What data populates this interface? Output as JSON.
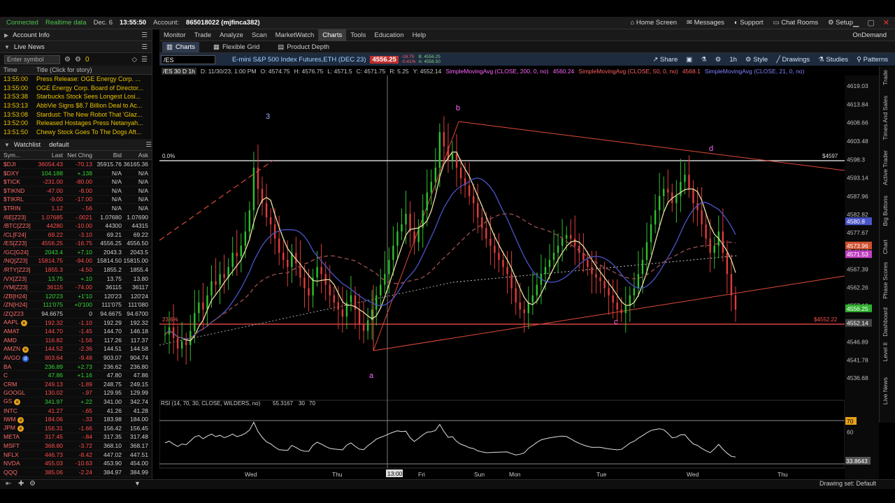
{
  "status": {
    "connected": "Connected",
    "realtime": "Realtime data",
    "date": "Dec. 6",
    "time": "13:55:50",
    "account_label": "Account:",
    "account": "865018022 (mjfinca382)"
  },
  "topnav": {
    "home": "Home Screen",
    "messages": "Messages",
    "support": "Support",
    "chat": "Chat Rooms",
    "setup": "Setup"
  },
  "left": {
    "account_info": "Account Info",
    "live_news": "Live News",
    "enter_symbol": "Enter symbol",
    "count": "0",
    "news_cols": [
      "Time",
      "Title (Click for story)"
    ],
    "news": [
      {
        "t": "13:55:00",
        "s": "Press Release: OGE Energy Corp. ..."
      },
      {
        "t": "13:55:00",
        "s": "OGE Energy Corp. Board of Director..."
      },
      {
        "t": "13:53:38",
        "s": "Starbucks Stock Sees Longest Losi..."
      },
      {
        "t": "13:53:13",
        "s": "AbbVie Signs $8.7 Billion Deal to Ac..."
      },
      {
        "t": "13:53:08",
        "s": "Stardust: The New Robot That 'Glaz..."
      },
      {
        "t": "13:52:00",
        "s": "Released Hostages Press Netanyah..."
      },
      {
        "t": "13:51:50",
        "s": "Chewy Stock Goes To The Dogs Aft..."
      }
    ],
    "watchlist_label": "Watchlist",
    "watchlist_name": "default",
    "wl_cols": [
      "Sym...",
      "Last",
      "Net Chng",
      "Bid",
      "Ask"
    ],
    "wl": [
      {
        "s": "$DJI",
        "l": "36054.43",
        "n": "-70.13",
        "b": "35915.76",
        "a": "36165.36",
        "d": "dn"
      },
      {
        "s": "$DXY",
        "l": "104.188",
        "n": "+.138",
        "b": "N/A",
        "a": "N/A",
        "d": "up"
      },
      {
        "s": "$TICK",
        "l": "-231.00",
        "n": "-80.00",
        "b": "N/A",
        "a": "N/A",
        "d": "dn"
      },
      {
        "s": "$TIKND",
        "l": "-47.00",
        "n": "-8.00",
        "b": "N/A",
        "a": "N/A",
        "d": "dn"
      },
      {
        "s": "$TIKRL",
        "l": "-9.00",
        "n": "-17.00",
        "b": "N/A",
        "a": "N/A",
        "d": "dn"
      },
      {
        "s": "$TRIN",
        "l": "1.12",
        "n": "-.56",
        "b": "N/A",
        "a": "N/A",
        "d": "dn"
      },
      {
        "s": "/6E[Z23]",
        "l": "1.07685",
        "n": "-.0021",
        "b": "1.07680",
        "a": "1.07690",
        "d": "dn"
      },
      {
        "s": "/BTC[Z23]",
        "l": "44280",
        "n": "-10.00",
        "b": "44300",
        "a": "44315",
        "d": "dn"
      },
      {
        "s": "/CL[F24]",
        "l": "69.22",
        "n": "-3.10",
        "b": "69.21",
        "a": "69.22",
        "d": "dn"
      },
      {
        "s": "/ES[Z23]",
        "l": "4556.25",
        "n": "-16.75",
        "b": "4556.25",
        "a": "4556.50",
        "d": "dn"
      },
      {
        "s": "/GC[G24]",
        "l": "2043.4",
        "n": "+7.10",
        "b": "2043.3",
        "a": "2043.5",
        "d": "up"
      },
      {
        "s": "/NQ[Z23]",
        "l": "15814.75",
        "n": "-94.00",
        "b": "15814.50",
        "a": "15815.00",
        "d": "dn"
      },
      {
        "s": "/RTY[Z23]",
        "l": "1855.3",
        "n": "-4.50",
        "b": "1855.2",
        "a": "1855.4",
        "d": "dn"
      },
      {
        "s": "/VX[Z23]",
        "l": "13.75",
        "n": "+.10",
        "b": "13.75",
        "a": "13.80",
        "d": "up"
      },
      {
        "s": "/YM[Z23]",
        "l": "36115",
        "n": "-74.00",
        "b": "36115",
        "a": "36117",
        "d": "dn"
      },
      {
        "s": "/ZB[H24]",
        "l": "120'23",
        "n": "+1'10",
        "b": "120'23",
        "a": "120'24",
        "d": "up"
      },
      {
        "s": "/ZN[H24]",
        "l": "111'075",
        "n": "+0'100",
        "b": "111'075",
        "a": "111'080",
        "d": "up"
      },
      {
        "s": "/ZQZ23",
        "l": "94.6675",
        "n": "0",
        "b": "94.6675",
        "a": "94.6700",
        "d": "neu"
      },
      {
        "s": "AAPL",
        "l": "192.32",
        "n": "-1.10",
        "b": "192.29",
        "a": "192.32",
        "d": "dn",
        "badge": "o"
      },
      {
        "s": "AMAT",
        "l": "144.70",
        "n": "-1.45",
        "b": "144.70",
        "a": "146.18",
        "d": "dn"
      },
      {
        "s": "AMD",
        "l": "116.82",
        "n": "-1.56",
        "b": "117.26",
        "a": "117.37",
        "d": "dn"
      },
      {
        "s": "AMZN",
        "l": "144.52",
        "n": "-2.36",
        "b": "144.51",
        "a": "144.58",
        "d": "dn",
        "badge": "o"
      },
      {
        "s": "AVGO",
        "l": "903.64",
        "n": "-9.48",
        "b": "903.07",
        "a": "904.74",
        "d": "dn",
        "badge": "b"
      },
      {
        "s": "BA",
        "l": "236.89",
        "n": "+2.73",
        "b": "236.62",
        "a": "236.80",
        "d": "up"
      },
      {
        "s": "C",
        "l": "47.86",
        "n": "+1.16",
        "b": "47.80",
        "a": "47.86",
        "d": "up"
      },
      {
        "s": "CRM",
        "l": "249.13",
        "n": "-1.89",
        "b": "248.75",
        "a": "249.15",
        "d": "dn"
      },
      {
        "s": "GOOGL",
        "l": "130.02",
        "n": "-.97",
        "b": "129.95",
        "a": "129.99",
        "d": "dn"
      },
      {
        "s": "GS",
        "l": "341.97",
        "n": "+.22",
        "b": "341.00",
        "a": "342.74",
        "d": "up",
        "badge": "o"
      },
      {
        "s": "INTC",
        "l": "41.27",
        "n": "-.65",
        "b": "41.26",
        "a": "41.28",
        "d": "dn"
      },
      {
        "s": "IWM",
        "l": "184.06",
        "n": "-.33",
        "b": "183.98",
        "a": "184.00",
        "d": "dn",
        "badge": "o"
      },
      {
        "s": "JPM",
        "l": "156.31",
        "n": "-1.66",
        "b": "156.42",
        "a": "156.45",
        "d": "dn",
        "badge": "o"
      },
      {
        "s": "META",
        "l": "317.45",
        "n": "-.84",
        "b": "317.35",
        "a": "317.48",
        "d": "dn"
      },
      {
        "s": "MSFT",
        "l": "368.80",
        "n": "-3.72",
        "b": "368.10",
        "a": "368.17",
        "d": "dn"
      },
      {
        "s": "NFLX",
        "l": "446.73",
        "n": "-8.42",
        "b": "447.02",
        "a": "447.51",
        "d": "dn"
      },
      {
        "s": "NVDA",
        "l": "455.03",
        "n": "-10.63",
        "b": "453.90",
        "a": "454.00",
        "d": "dn"
      },
      {
        "s": "QQQ",
        "l": "385.06",
        "n": "-2.24",
        "b": "384.97",
        "a": "384.99",
        "d": "dn"
      }
    ]
  },
  "menu": [
    "Monitor",
    "Trade",
    "Analyze",
    "Scan",
    "MarketWatch",
    "Charts",
    "Tools",
    "Education",
    "Help"
  ],
  "ondemand": "OnDemand",
  "subtabs": {
    "charts": "Charts",
    "grid": "Flexible Grid",
    "depth": "Product Depth"
  },
  "chart_header": {
    "symbol": "/ES",
    "desc": "E-mini S&P 500 Index Futures,ETH (DEC 23)",
    "price": "4556.25",
    "chg": "-16.75",
    "pct": "-0.41%",
    "bid": "B: 4556.25",
    "ask": "A: 4556.50",
    "share": "Share",
    "tf": "1h",
    "style": "Style",
    "drawings": "Drawings",
    "studies": "Studies",
    "patterns": "Patterns"
  },
  "info": {
    "label": "/ES 30 D 1h",
    "date": "D: 11/30/23, 1:00 PM",
    "o": "O: 4574.75",
    "h": "H: 4576.75",
    "l": "L: 4571.5",
    "c": "C: 4571.75",
    "r": "R: 5.25",
    "y": "Y: 4552.14",
    "sma200": "SimpleMovingAvg (CLOSE, 200, 0, no)",
    "sma200v": "4560.24",
    "sma50": "SimpleMovingAvg (CLOSE, 50, 0, no)",
    "sma50v": "4568.1",
    "sma21": "SimpleMovingAvg (CLOSE, 21, 0, no)"
  },
  "rsi": {
    "label": "RSI (14, 70, 30, CLOSE, WILDERS, no)",
    "value": "55.3167",
    "lo": "30",
    "hi": "70"
  },
  "sidetabs": [
    "Trade",
    "Times And Sales",
    "Active Trader",
    "Big Buttons",
    "Chart",
    "Phase Scores",
    "Dashboard",
    "Level II",
    "Live News"
  ],
  "drawing_set": "Drawing set: Default",
  "colors": {
    "up": "#33d633",
    "down": "#ff4d4d",
    "accent": "#e8c200",
    "header": "#1e2b3f"
  },
  "chart_data": {
    "type": "candlestick",
    "ylim": [
      4531,
      4622
    ],
    "y_ticks": [
      "4619.03",
      "4613.84",
      "4608.66",
      "4603.48",
      "4598.3",
      "4593.14",
      "4587.96",
      "4582.82",
      "4577.67",
      "4572.52",
      "4567.39",
      "4562.26",
      "4557.13",
      "4546.89",
      "4541.78",
      "4536.68"
    ],
    "x_labels": [
      "Wed",
      "Thu",
      "Fri",
      "Sun",
      "Mon",
      "Tue",
      "Wed",
      "Thu"
    ],
    "cursor_time": "13:00",
    "wave_labels": [
      "3",
      "b",
      "a",
      "c",
      "d"
    ],
    "fib_labels": [
      "0.0%",
      "23.6%"
    ],
    "price_levels": {
      "top": "$4597",
      "bottom": "$4552.22"
    },
    "right_tags": {
      "sma21": "4580.8",
      "sma50": "4573.96",
      "sma200": "4571.53",
      "last": "4556.25",
      "y": "4552.14"
    },
    "rsi_ticks": [
      "70",
      "60",
      "33.8643"
    ],
    "closes": [
      4549,
      4551,
      4548,
      4545,
      4547,
      4546,
      4550,
      4555,
      4558,
      4556,
      4560,
      4564,
      4563,
      4566,
      4565,
      4568,
      4572,
      4571,
      4574,
      4578,
      4584,
      4596,
      4590,
      4586,
      4582,
      4580,
      4576,
      4572,
      4570,
      4568,
      4572,
      4569,
      4565,
      4562,
      4560,
      4565,
      4568,
      4566,
      4563,
      4560,
      4558,
      4556,
      4554,
      4558,
      4560,
      4556,
      4552,
      4550,
      4553,
      4556,
      4560,
      4563,
      4566,
      4570,
      4574,
      4578,
      4580,
      4583,
      4578,
      4575,
      4579,
      4584,
      4589,
      4592,
      4596,
      4606,
      4602,
      4598,
      4600,
      4596,
      4593,
      4591,
      4588,
      4586,
      4582,
      4579,
      4576,
      4574,
      4572,
      4570,
      4568,
      4566,
      4562,
      4558,
      4556,
      4555,
      4558,
      4560,
      4563,
      4566,
      4568,
      4570,
      4572,
      4574,
      4576,
      4577,
      4576,
      4574,
      4572,
      4570,
      4568,
      4566,
      4565,
      4564,
      4562,
      4560,
      4558,
      4556,
      4555,
      4557,
      4560,
      4562,
      4566,
      4570,
      4575,
      4580,
      4584,
      4588,
      4590,
      4589,
      4586,
      4588,
      4592,
      4594,
      4590,
      4586,
      4584,
      4580,
      4576,
      4572,
      4574,
      4578,
      4572,
      4566,
      4560,
      4556
    ]
  }
}
